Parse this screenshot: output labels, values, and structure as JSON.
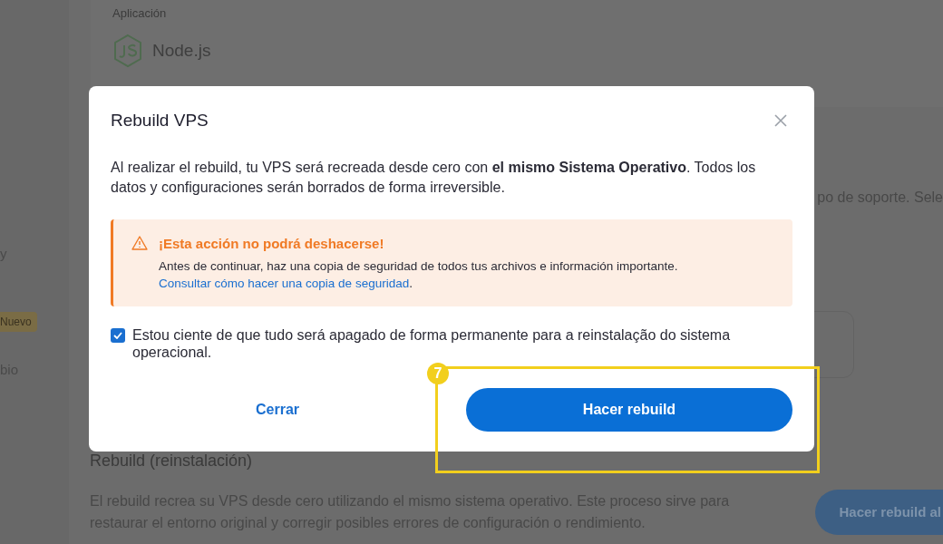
{
  "background": {
    "sidebar": [
      {
        "kind": "link",
        "label": "y"
      },
      {
        "kind": "badge",
        "label": "Nuevo"
      },
      {
        "kind": "link",
        "label": "bio"
      }
    ],
    "server_card": {
      "label": "Aplicación",
      "app": "Node.js"
    },
    "support_text": "po de soporte. Sele",
    "rebuild_section": {
      "title": "Rebuild (reinstalación)",
      "description": "El rebuild recrea su VPS desde cero utilizando el mismo sistema operativo. Este proceso sirve para restaurar el entorno original y corregir posibles errores de configuración o rendimiento.",
      "button": "Hacer rebuild al"
    }
  },
  "dialog": {
    "title": "Rebuild VPS",
    "body": "Al realizar el rebuild, tu VPS será recreada desde cero con **el mismo Sistema Operativo**. Todos los datos y configuraciones serán borrados de forma irreversible.",
    "alert": {
      "title": "¡Esta acción no podrá deshacerse!",
      "text": "Antes de continuar, haz una copia de seguridad de todos tus archivos e información importante.",
      "link": "Consultar cómo hacer una copia de seguridad",
      "after_link": "."
    },
    "confirm": {
      "label": "Estou ciente de que tudo será apagado de forma permanente para a reinstalação do sistema operacional.",
      "checked": true
    },
    "buttons": [
      {
        "kind": "secondary",
        "label": "Cerrar"
      },
      {
        "kind": "primary",
        "label": "Hacer rebuild"
      }
    ]
  },
  "annotation": {
    "number": "7"
  }
}
